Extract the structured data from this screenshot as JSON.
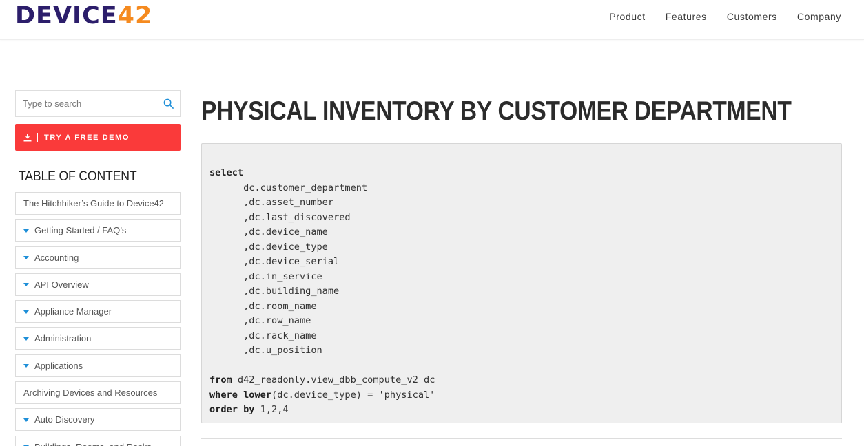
{
  "brand": {
    "logo_main": "DEVICE",
    "logo_accent": "42"
  },
  "nav": {
    "items": [
      "Product",
      "Features",
      "Customers",
      "Company"
    ]
  },
  "sidebar": {
    "search_placeholder": "Type to search",
    "demo_button": "TRY A FREE DEMO",
    "toc_title": "TABLE OF CONTENT",
    "items": [
      {
        "label": "The Hitchhiker’s Guide to Device42",
        "expandable": false
      },
      {
        "label": "Getting Started / FAQ’s",
        "expandable": true
      },
      {
        "label": "Accounting",
        "expandable": true
      },
      {
        "label": "API Overview",
        "expandable": true
      },
      {
        "label": "Appliance Manager",
        "expandable": true
      },
      {
        "label": "Administration",
        "expandable": true
      },
      {
        "label": "Applications",
        "expandable": true
      },
      {
        "label": "Archiving Devices and Resources",
        "expandable": false
      },
      {
        "label": "Auto Discovery",
        "expandable": true
      },
      {
        "label": "Buildings, Rooms, and Racks",
        "expandable": true
      }
    ]
  },
  "main": {
    "title": "PHYSICAL INVENTORY BY CUSTOMER DEPARTMENT",
    "code_lines": [
      [
        {
          "t": "select",
          "kw": true
        }
      ],
      [
        {
          "t": "      dc.customer_department"
        }
      ],
      [
        {
          "t": "      ,dc.asset_number"
        }
      ],
      [
        {
          "t": "      ,dc.last_discovered"
        }
      ],
      [
        {
          "t": "      ,dc.device_name"
        }
      ],
      [
        {
          "t": "      ,dc.device_type"
        }
      ],
      [
        {
          "t": "      ,dc.device_serial"
        }
      ],
      [
        {
          "t": "      ,dc.in_service"
        }
      ],
      [
        {
          "t": "      ,dc.building_name"
        }
      ],
      [
        {
          "t": "      ,dc.room_name"
        }
      ],
      [
        {
          "t": "      ,dc.row_name"
        }
      ],
      [
        {
          "t": "      ,dc.rack_name"
        }
      ],
      [
        {
          "t": "      ,dc.u_position"
        }
      ],
      [
        {
          "t": ""
        }
      ],
      [
        {
          "t": "from",
          "kw": true
        },
        {
          "t": " d42_readonly.view_dbb_compute_v2 dc"
        }
      ],
      [
        {
          "t": "where",
          "kw": true
        },
        {
          "t": " "
        },
        {
          "t": "lower",
          "kw": true
        },
        {
          "t": "(dc.device_type) = 'physical'"
        }
      ],
      [
        {
          "t": "order",
          "kw": true
        },
        {
          "t": " "
        },
        {
          "t": "by",
          "kw": true
        },
        {
          "t": " 1,2,4"
        }
      ]
    ]
  },
  "colors": {
    "brand_dark": "#2c1e6b",
    "brand_orange": "#f58a1f",
    "demo_red": "#fa3a3a",
    "caret_blue": "#1e8fd8"
  },
  "icons": {
    "search": "search-icon",
    "download": "download-icon",
    "caret": "caret-down-icon"
  }
}
